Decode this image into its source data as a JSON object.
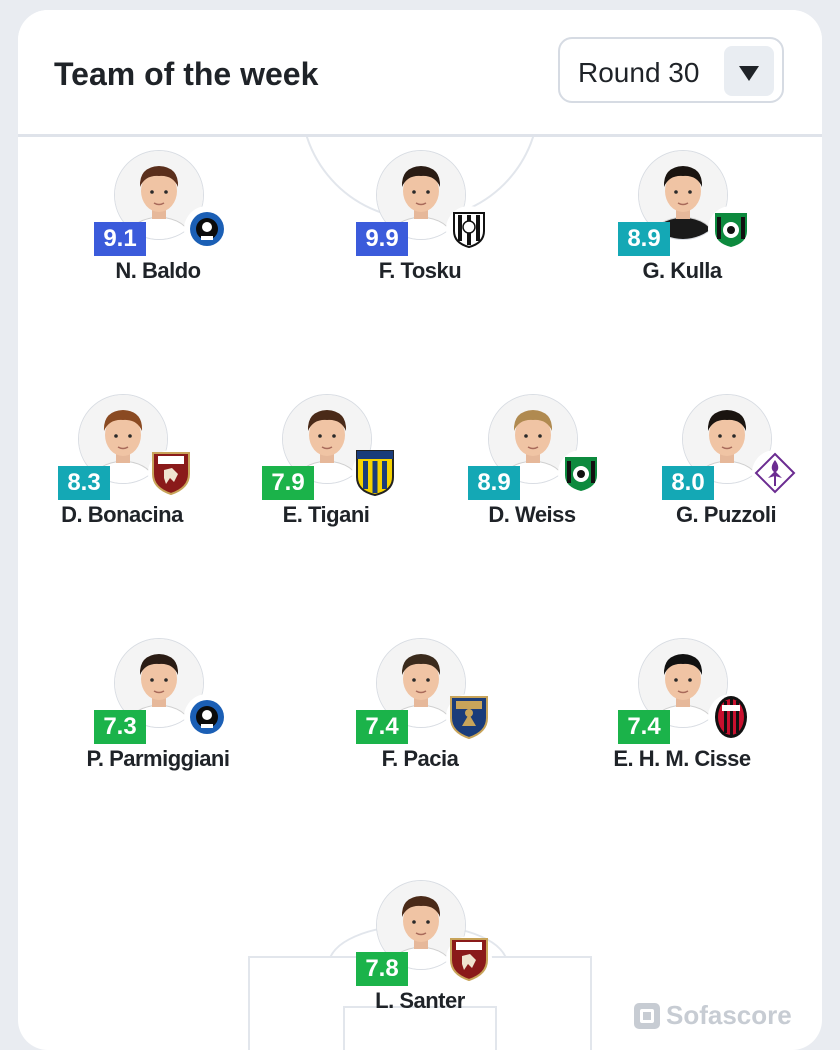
{
  "header": {
    "title": "Team of the week",
    "round_label": "Round 30"
  },
  "colors": {
    "rating_blue": "#3b5bdb",
    "rating_teal": "#14a8b5",
    "rating_green": "#1bb34a"
  },
  "players": [
    {
      "name": "N. Baldo",
      "rating": "9.1",
      "rating_color": "#3b5bdb",
      "club_icon": "atalanta-crest-icon",
      "kit_color": "#ffffff",
      "hair_color": "#5a2f1c"
    },
    {
      "name": "F. Tosku",
      "rating": "9.9",
      "rating_color": "#3b5bdb",
      "club_icon": "cesena-crest-icon",
      "kit_color": "#ffffff",
      "hair_color": "#2a1c14"
    },
    {
      "name": "G. Kulla",
      "rating": "8.9",
      "rating_color": "#14a8b5",
      "club_icon": "sassuolo-crest-icon",
      "kit_color": "#1a1a1a",
      "hair_color": "#1a1410"
    },
    {
      "name": "D. Bonacina",
      "rating": "8.3",
      "rating_color": "#14a8b5",
      "club_icon": "torino-crest-icon",
      "kit_color": "#ffffff",
      "hair_color": "#8a4a22"
    },
    {
      "name": "E. Tigani",
      "rating": "7.9",
      "rating_color": "#1bb34a",
      "club_icon": "parma-crest-icon",
      "kit_color": "#ffffff",
      "hair_color": "#4a2a18"
    },
    {
      "name": "D. Weiss",
      "rating": "8.9",
      "rating_color": "#14a8b5",
      "club_icon": "sassuolo-crest-icon",
      "kit_color": "#ffffff",
      "hair_color": "#b08a50"
    },
    {
      "name": "G. Puzzoli",
      "rating": "8.0",
      "rating_color": "#14a8b5",
      "club_icon": "fiorentina-crest-icon",
      "kit_color": "#ffffff",
      "hair_color": "#1a1410"
    },
    {
      "name": "P. Parmiggiani",
      "rating": "7.3",
      "rating_color": "#1bb34a",
      "club_icon": "atalanta-crest-icon",
      "kit_color": "#ffffff",
      "hair_color": "#2a1c14"
    },
    {
      "name": "F. Pacia",
      "rating": "7.4",
      "rating_color": "#1bb34a",
      "club_icon": "lecce-crest-icon",
      "kit_color": "#ffffff",
      "hair_color": "#3a2a1c"
    },
    {
      "name": "E. H. M. Cisse",
      "rating": "7.4",
      "rating_color": "#1bb34a",
      "club_icon": "milan-crest-icon",
      "kit_color": "#ffffff",
      "hair_color": "#111111"
    },
    {
      "name": "L. Santer",
      "rating": "7.8",
      "rating_color": "#1bb34a",
      "club_icon": "torino-crest-icon",
      "kit_color": "#ffffff",
      "hair_color": "#4a2a18"
    }
  ],
  "watermark": {
    "text": "Sofascore",
    "icon": "sofascore-logo-icon"
  }
}
